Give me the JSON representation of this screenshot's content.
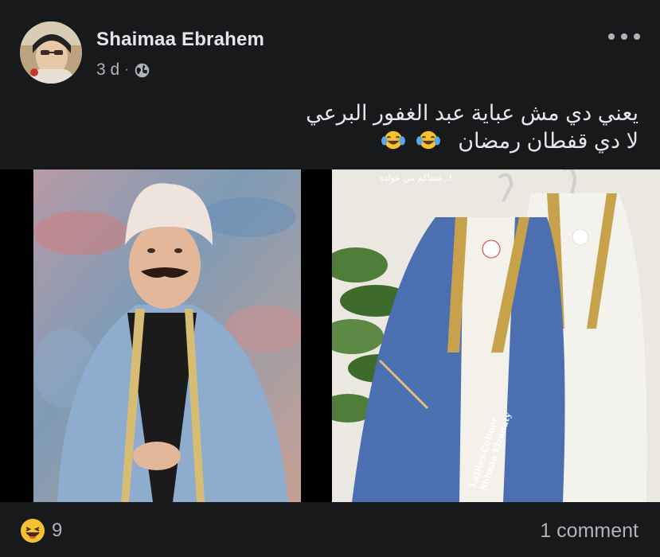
{
  "author": {
    "name": "Shaimaa Ebrahem"
  },
  "meta": {
    "time": "3 d",
    "separator": "·",
    "privacy_icon": "globe-icon"
  },
  "post": {
    "line1": "يعني دي مش عباية عبد الغفور البرعي",
    "line2": "لا دي قفطان رمضان",
    "emojis": [
      "face-with-tears-of-joy",
      "face-with-tears-of-joy"
    ]
  },
  "media": {
    "right_caption": "عساكم من عواده..!",
    "watermark_line1": "LaDies CoRner",
    "watermark_line2": "Shimaa Elzanaty"
  },
  "footer": {
    "reaction_icon": "haha-emoji-icon",
    "reaction_count": "9",
    "comments": "1 comment"
  },
  "colors": {
    "background": "#18191a",
    "primary_text": "#e4e6eb",
    "secondary_text": "#b0b3b8"
  }
}
